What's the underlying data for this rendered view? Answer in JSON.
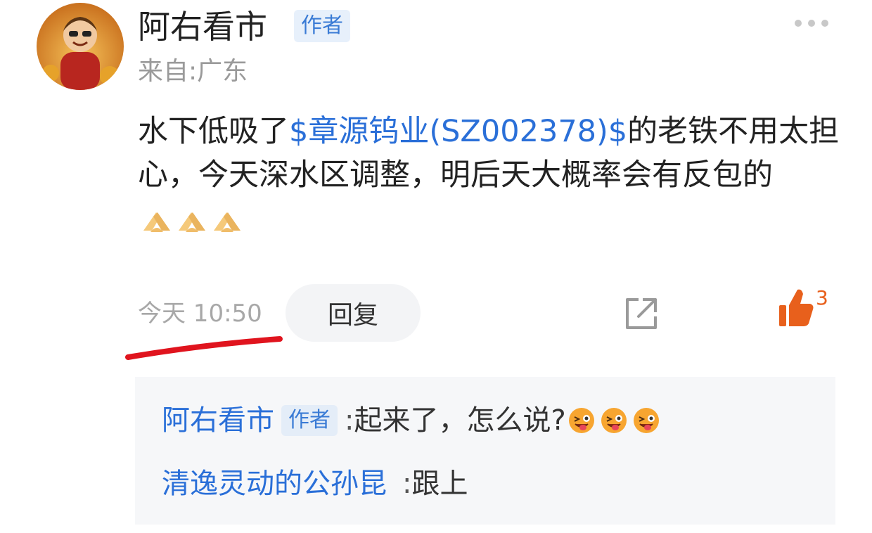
{
  "post": {
    "author": "阿右看市",
    "author_badge": "作者",
    "location": "来自:广东",
    "content_prefix": "水下低吸了",
    "stock_tag": "$章源钨业(SZ002378)$",
    "content_suffix": "的老铁不用太担心，今天深水区调整，明后天大概率会有反包的",
    "emoji": "clasped-hands-emoji",
    "time": "今天 10:50",
    "reply_label": "回复",
    "like_count": "3"
  },
  "replies": [
    {
      "name": "阿右看市",
      "badge": "作者",
      "colon": ":",
      "text": "起来了，怎么说?",
      "emoji": "winking-face-with-tongue-emoji"
    },
    {
      "name": "清逸灵动的公孙昆",
      "badge": "",
      "colon": ":",
      "text": "跟上"
    }
  ],
  "colors": {
    "link": "#2a6fd8",
    "like": "#e8601c",
    "annotation": "#e0141e"
  }
}
